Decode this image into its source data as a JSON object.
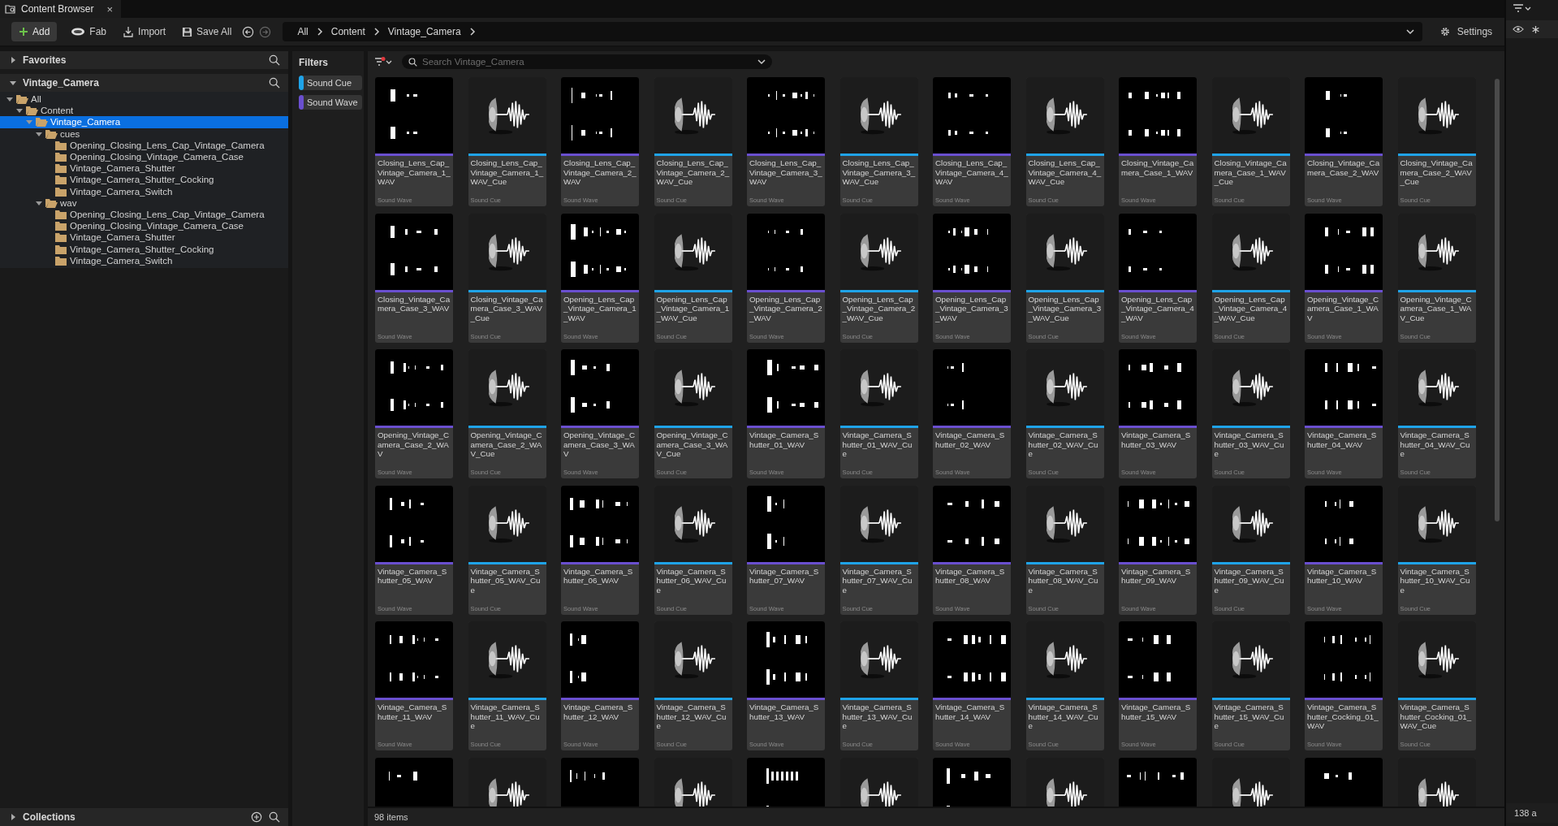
{
  "tab": {
    "title": "Content Browser",
    "close": "×"
  },
  "toolbar": {
    "buttons": [
      {
        "kind": "add",
        "label": "Add"
      },
      {
        "kind": "fab",
        "label": "Fab"
      },
      {
        "kind": "import",
        "label": "Import"
      },
      {
        "kind": "save",
        "label": "Save All"
      }
    ],
    "history": [
      {
        "kind": "back",
        "disabled": false
      },
      {
        "kind": "forward",
        "disabled": true
      }
    ],
    "breadcrumb": [
      "All",
      "Content",
      "Vintage_Camera"
    ],
    "settings": "Settings"
  },
  "sidebar": {
    "favorites": {
      "title": "Favorites",
      "expanded": false
    },
    "folder_panel": {
      "title": "Vintage_Camera",
      "expanded": true
    },
    "tree": [
      {
        "label": "All",
        "expanded": true,
        "selected": false,
        "children": [
          {
            "label": "Content",
            "expanded": true,
            "selected": false,
            "children": [
              {
                "label": "Vintage_Camera",
                "expanded": true,
                "selected": true,
                "children": [
                  {
                    "label": "cues",
                    "expanded": true,
                    "selected": false,
                    "children": [
                      {
                        "label": "Opening_Closing_Lens_Cap_Vintage_Camera",
                        "selected": false
                      },
                      {
                        "label": "Opening_Closing_Vintage_Camera_Case",
                        "selected": false
                      },
                      {
                        "label": "Vintage_Camera_Shutter",
                        "selected": false
                      },
                      {
                        "label": "Vintage_Camera_Shutter_Cocking",
                        "selected": false
                      },
                      {
                        "label": "Vintage_Camera_Switch",
                        "selected": false
                      }
                    ]
                  },
                  {
                    "label": "wav",
                    "expanded": true,
                    "selected": false,
                    "children": [
                      {
                        "label": "Opening_Closing_Lens_Cap_Vintage_Camera",
                        "selected": false
                      },
                      {
                        "label": "Opening_Closing_Vintage_Camera_Case",
                        "selected": false
                      },
                      {
                        "label": "Vintage_Camera_Shutter",
                        "selected": false
                      },
                      {
                        "label": "Vintage_Camera_Shutter_Cocking",
                        "selected": false
                      },
                      {
                        "label": "Vintage_Camera_Switch",
                        "selected": false
                      }
                    ]
                  }
                ]
              }
            ]
          }
        ]
      }
    ],
    "collections": {
      "title": "Collections",
      "expanded": false
    }
  },
  "filters": {
    "title": "Filters",
    "items": [
      {
        "label": "Sound Cue",
        "color": "#1fa3e8"
      },
      {
        "label": "Sound Wave",
        "color": "#6a4fcf"
      }
    ]
  },
  "search": {
    "placeholder": "Search Vintage_Camera"
  },
  "assets": [
    {
      "name": "Closing_Lens_Cap_Vintage_Camera_1_WAV",
      "type": "Sound Wave",
      "kind": "wave"
    },
    {
      "name": "Closing_Lens_Cap_Vintage_Camera_1_WAV_Cue",
      "type": "Sound Cue",
      "kind": "cue"
    },
    {
      "name": "Closing_Lens_Cap_Vintage_Camera_2_WAV",
      "type": "Sound Wave",
      "kind": "wave"
    },
    {
      "name": "Closing_Lens_Cap_Vintage_Camera_2_WAV_Cue",
      "type": "Sound Cue",
      "kind": "cue"
    },
    {
      "name": "Closing_Lens_Cap_Vintage_Camera_3_WAV",
      "type": "Sound Wave",
      "kind": "wave"
    },
    {
      "name": "Closing_Lens_Cap_Vintage_Camera_3_WAV_Cue",
      "type": "Sound Cue",
      "kind": "cue"
    },
    {
      "name": "Closing_Lens_Cap_Vintage_Camera_4_WAV",
      "type": "Sound Wave",
      "kind": "wave"
    },
    {
      "name": "Closing_Lens_Cap_Vintage_Camera_4_WAV_Cue",
      "type": "Sound Cue",
      "kind": "cue"
    },
    {
      "name": "Closing_Vintage_Camera_Case_1_WAV",
      "type": "Sound Wave",
      "kind": "wave"
    },
    {
      "name": "Closing_Vintage_Camera_Case_1_WAV_Cue",
      "type": "Sound Cue",
      "kind": "cue"
    },
    {
      "name": "Closing_Vintage_Camera_Case_2_WAV",
      "type": "Sound Wave",
      "kind": "wave"
    },
    {
      "name": "Closing_Vintage_Camera_Case_2_WAV_Cue",
      "type": "Sound Cue",
      "kind": "cue"
    },
    {
      "name": "Closing_Vintage_Camera_Case_3_WAV",
      "type": "Sound Wave",
      "kind": "wave"
    },
    {
      "name": "Closing_Vintage_Camera_Case_3_WAV_Cue",
      "type": "Sound Cue",
      "kind": "cue"
    },
    {
      "name": "Opening_Lens_Cap_Vintage_Camera_1_WAV",
      "type": "Sound Wave",
      "kind": "wave"
    },
    {
      "name": "Opening_Lens_Cap_Vintage_Camera_1_WAV_Cue",
      "type": "Sound Cue",
      "kind": "cue"
    },
    {
      "name": "Opening_Lens_Cap_Vintage_Camera_2_WAV",
      "type": "Sound Wave",
      "kind": "wave"
    },
    {
      "name": "Opening_Lens_Cap_Vintage_Camera_2_WAV_Cue",
      "type": "Sound Cue",
      "kind": "cue"
    },
    {
      "name": "Opening_Lens_Cap_Vintage_Camera_3_WAV",
      "type": "Sound Wave",
      "kind": "wave"
    },
    {
      "name": "Opening_Lens_Cap_Vintage_Camera_3_WAV_Cue",
      "type": "Sound Cue",
      "kind": "cue"
    },
    {
      "name": "Opening_Lens_Cap_Vintage_Camera_4_WAV",
      "type": "Sound Wave",
      "kind": "wave"
    },
    {
      "name": "Opening_Lens_Cap_Vintage_Camera_4_WAV_Cue",
      "type": "Sound Cue",
      "kind": "cue"
    },
    {
      "name": "Opening_Vintage_Camera_Case_1_WAV",
      "type": "Sound Wave",
      "kind": "wave"
    },
    {
      "name": "Opening_Vintage_Camera_Case_1_WAV_Cue",
      "type": "Sound Cue",
      "kind": "cue"
    },
    {
      "name": "Opening_Vintage_Camera_Case_2_WAV",
      "type": "Sound Wave",
      "kind": "wave"
    },
    {
      "name": "Opening_Vintage_Camera_Case_2_WAV_Cue",
      "type": "Sound Cue",
      "kind": "cue"
    },
    {
      "name": "Opening_Vintage_Camera_Case_3_WAV",
      "type": "Sound Wave",
      "kind": "wave"
    },
    {
      "name": "Opening_Vintage_Camera_Case_3_WAV_Cue",
      "type": "Sound Cue",
      "kind": "cue"
    },
    {
      "name": "Vintage_Camera_Shutter_01_WAV",
      "type": "Sound Wave",
      "kind": "wave"
    },
    {
      "name": "Vintage_Camera_Shutter_01_WAV_Cue",
      "type": "Sound Cue",
      "kind": "cue"
    },
    {
      "name": "Vintage_Camera_Shutter_02_WAV",
      "type": "Sound Wave",
      "kind": "wave"
    },
    {
      "name": "Vintage_Camera_Shutter_02_WAV_Cue",
      "type": "Sound Cue",
      "kind": "cue"
    },
    {
      "name": "Vintage_Camera_Shutter_03_WAV",
      "type": "Sound Wave",
      "kind": "wave"
    },
    {
      "name": "Vintage_Camera_Shutter_03_WAV_Cue",
      "type": "Sound Cue",
      "kind": "cue"
    },
    {
      "name": "Vintage_Camera_Shutter_04_WAV",
      "type": "Sound Wave",
      "kind": "wave"
    },
    {
      "name": "Vintage_Camera_Shutter_04_WAV_Cue",
      "type": "Sound Cue",
      "kind": "cue"
    },
    {
      "name": "Vintage_Camera_Shutter_05_WAV",
      "type": "Sound Wave",
      "kind": "wave"
    },
    {
      "name": "Vintage_Camera_Shutter_05_WAV_Cue",
      "type": "Sound Cue",
      "kind": "cue"
    },
    {
      "name": "Vintage_Camera_Shutter_06_WAV",
      "type": "Sound Wave",
      "kind": "wave"
    },
    {
      "name": "Vintage_Camera_Shutter_06_WAV_Cue",
      "type": "Sound Cue",
      "kind": "cue"
    },
    {
      "name": "Vintage_Camera_Shutter_07_WAV",
      "type": "Sound Wave",
      "kind": "wave"
    },
    {
      "name": "Vintage_Camera_Shutter_07_WAV_Cue",
      "type": "Sound Cue",
      "kind": "cue"
    },
    {
      "name": "Vintage_Camera_Shutter_08_WAV",
      "type": "Sound Wave",
      "kind": "wave"
    },
    {
      "name": "Vintage_Camera_Shutter_08_WAV_Cue",
      "type": "Sound Cue",
      "kind": "cue"
    },
    {
      "name": "Vintage_Camera_Shutter_09_WAV",
      "type": "Sound Wave",
      "kind": "wave"
    },
    {
      "name": "Vintage_Camera_Shutter_09_WAV_Cue",
      "type": "Sound Cue",
      "kind": "cue"
    },
    {
      "name": "Vintage_Camera_Shutter_10_WAV",
      "type": "Sound Wave",
      "kind": "wave"
    },
    {
      "name": "Vintage_Camera_Shutter_10_WAV_Cue",
      "type": "Sound Cue",
      "kind": "cue"
    },
    {
      "name": "Vintage_Camera_Shutter_11_WAV",
      "type": "Sound Wave",
      "kind": "wave"
    },
    {
      "name": "Vintage_Camera_Shutter_11_WAV_Cue",
      "type": "Sound Cue",
      "kind": "cue"
    },
    {
      "name": "Vintage_Camera_Shutter_12_WAV",
      "type": "Sound Wave",
      "kind": "wave"
    },
    {
      "name": "Vintage_Camera_Shutter_12_WAV_Cue",
      "type": "Sound Cue",
      "kind": "cue"
    },
    {
      "name": "Vintage_Camera_Shutter_13_WAV",
      "type": "Sound Wave",
      "kind": "wave"
    },
    {
      "name": "Vintage_Camera_Shutter_13_WAV_Cue",
      "type": "Sound Cue",
      "kind": "cue"
    },
    {
      "name": "Vintage_Camera_Shutter_14_WAV",
      "type": "Sound Wave",
      "kind": "wave"
    },
    {
      "name": "Vintage_Camera_Shutter_14_WAV_Cue",
      "type": "Sound Cue",
      "kind": "cue"
    },
    {
      "name": "Vintage_Camera_Shutter_15_WAV",
      "type": "Sound Wave",
      "kind": "wave"
    },
    {
      "name": "Vintage_Camera_Shutter_15_WAV_Cue",
      "type": "Sound Cue",
      "kind": "cue"
    },
    {
      "name": "Vintage_Camera_Shutter_Cocking_01_WAV",
      "type": "Sound Wave",
      "kind": "wave"
    },
    {
      "name": "Vintage_Camera_Shutter_Cocking_01_WAV_Cue",
      "type": "Sound Cue",
      "kind": "cue"
    },
    {
      "kind": "wave"
    },
    {
      "kind": "cue"
    },
    {
      "kind": "wave"
    },
    {
      "kind": "cue"
    },
    {
      "kind": "wave"
    },
    {
      "kind": "cue"
    },
    {
      "kind": "wave"
    },
    {
      "kind": "cue"
    },
    {
      "kind": "wave"
    },
    {
      "kind": "cue"
    },
    {
      "kind": "wave"
    },
    {
      "kind": "cue"
    }
  ],
  "status": "98 items",
  "side_strip": {
    "count": "138 a"
  }
}
